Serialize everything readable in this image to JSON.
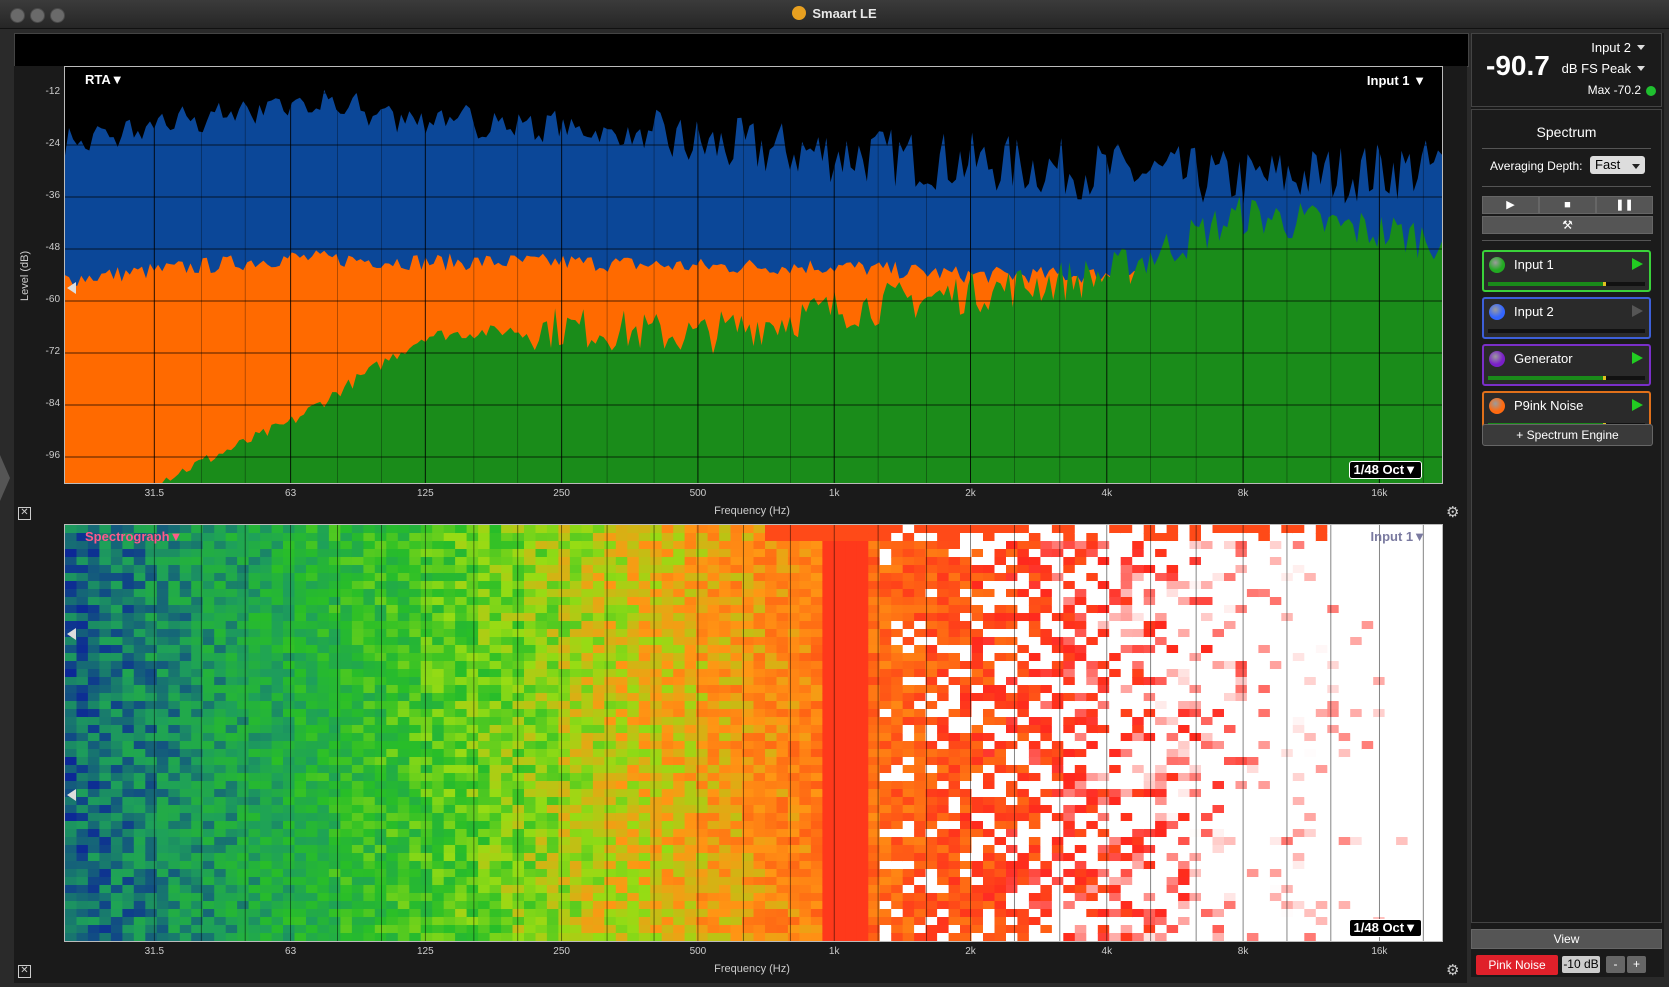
{
  "window": {
    "title": "Smaart LE"
  },
  "rta": {
    "title": "RTA",
    "input_label": "Input 1",
    "resolution": "1/48 Oct",
    "ylabel": "Level (dB)",
    "xlabel": "Frequency (Hz)",
    "yticks": [
      "-12",
      "-24",
      "-36",
      "-48",
      "-60",
      "-72",
      "-84",
      "-96"
    ],
    "xticks": [
      "31.5",
      "63",
      "125",
      "250",
      "500",
      "1k",
      "2k",
      "4k",
      "8k",
      "16k"
    ]
  },
  "spectrograph": {
    "title": "Spectrograph",
    "input_label": "Input 1",
    "resolution": "1/48 Oct",
    "xlabel": "Frequency (Hz)",
    "xticks": [
      "31.5",
      "63",
      "125",
      "250",
      "500",
      "1k",
      "2k",
      "4k",
      "8k",
      "16k"
    ]
  },
  "meter": {
    "value": "-90.7",
    "source": "Input 2",
    "mode": "dB FS Peak",
    "max": "Max -70.2"
  },
  "panel": {
    "title": "Spectrum",
    "averaging_label": "Averaging Depth:",
    "averaging_value": "Fast",
    "transport": {
      "play": "▶",
      "stop": "■",
      "pause": "❚❚",
      "tools": "⚒"
    },
    "inputs": [
      {
        "label": "Input 1",
        "color": "#22aa22",
        "border": "#3ad23a",
        "level": 0.73
      },
      {
        "label": "Input 2",
        "color": "#3366ff",
        "border": "#3d5fd8",
        "level": 0.0
      },
      {
        "label": "Generator",
        "color": "#7a1fc9",
        "border": "#7a2fc9",
        "level": 0.73
      },
      {
        "label": "P9ink Noise",
        "color": "#ff6a10",
        "border": "#e0701a",
        "level": 0.73
      }
    ],
    "add_engine": "+ Spectrum Engine"
  },
  "bottom": {
    "view": "View",
    "pink_noise": "Pink Noise",
    "level": "-10 dB",
    "minus": "-",
    "plus": "+"
  },
  "chart_data": [
    {
      "type": "area",
      "title": "RTA",
      "xlabel": "Frequency (Hz)",
      "ylabel": "Level (dB)",
      "x_scale": "log",
      "ylim": [
        -102,
        -6
      ],
      "grid": true,
      "categories": [
        "31.5",
        "63",
        "125",
        "250",
        "500",
        "1k",
        "2k",
        "4k",
        "8k",
        "16k"
      ],
      "series": [
        {
          "name": "Input 2",
          "color": "#0b4798",
          "values": [
            -20,
            -14,
            -18,
            -20,
            -24,
            -26,
            -28,
            -30,
            -32,
            -30
          ]
        },
        {
          "color": "#ff6a00",
          "values": [
            -53,
            -50,
            -51,
            -51,
            -52,
            -52,
            -54,
            -54,
            -52,
            -54
          ]
        },
        {
          "name": "Input 1",
          "color": "#1a8c1a",
          "values": [
            -102,
            -88,
            -68,
            -66,
            -68,
            -62,
            -58,
            -54,
            -40,
            -44
          ]
        }
      ]
    },
    {
      "type": "heatmap",
      "title": "Spectrograph",
      "xlabel": "Frequency (Hz)",
      "x_scale": "log",
      "categories": [
        "31.5",
        "63",
        "125",
        "250",
        "500",
        "1k",
        "2k",
        "4k",
        "8k",
        "16k"
      ]
    }
  ]
}
